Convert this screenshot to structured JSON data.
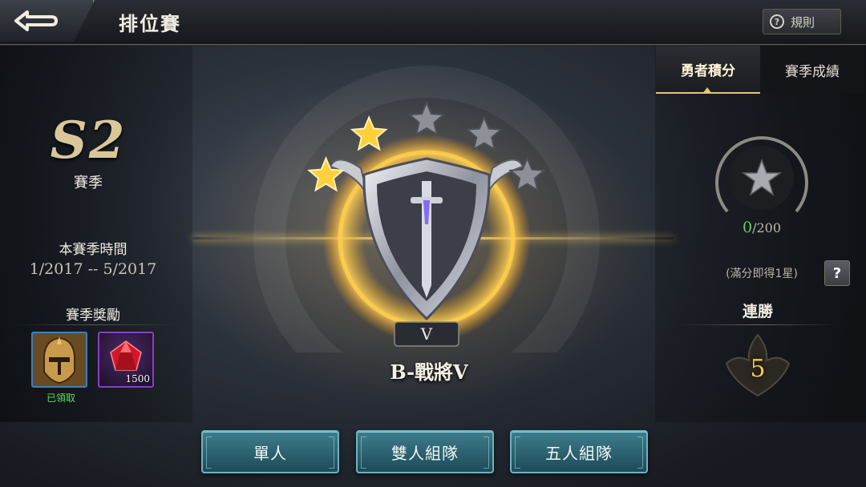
{
  "header": {
    "title": "排位賽",
    "rules_label": "規則",
    "back_icon": "back-arrow-icon"
  },
  "season": {
    "code": "S2",
    "label": "賽季",
    "period_title": "本賽季時間",
    "period_value": "1/2017 -- 5/2017",
    "rewards_title": "賽季獎勵",
    "rewards": [
      {
        "icon": "hero-skin-icon",
        "status": "已領取"
      },
      {
        "icon": "red-gem-icon",
        "amount": "1500"
      }
    ]
  },
  "rank": {
    "stars_filled": 2,
    "stars_total": 5,
    "tier_numeral": "V",
    "label": "B-戰將V"
  },
  "tabs": [
    {
      "label": "勇者積分",
      "active": true
    },
    {
      "label": "賽季成績",
      "active": false
    }
  ],
  "points": {
    "current": "0",
    "max": "/200",
    "hint": "(滿分即得1星)",
    "help_label": "?"
  },
  "streak": {
    "title": "連勝",
    "value": "5"
  },
  "modes": [
    {
      "label": "單人"
    },
    {
      "label": "雙人組隊"
    },
    {
      "label": "五人組隊"
    }
  ],
  "colors": {
    "accent_gold": "#e7c66f",
    "claimed_green": "#5ede5e",
    "streak_gold": "#f3c84b",
    "button_teal": "#2f6f7e"
  }
}
